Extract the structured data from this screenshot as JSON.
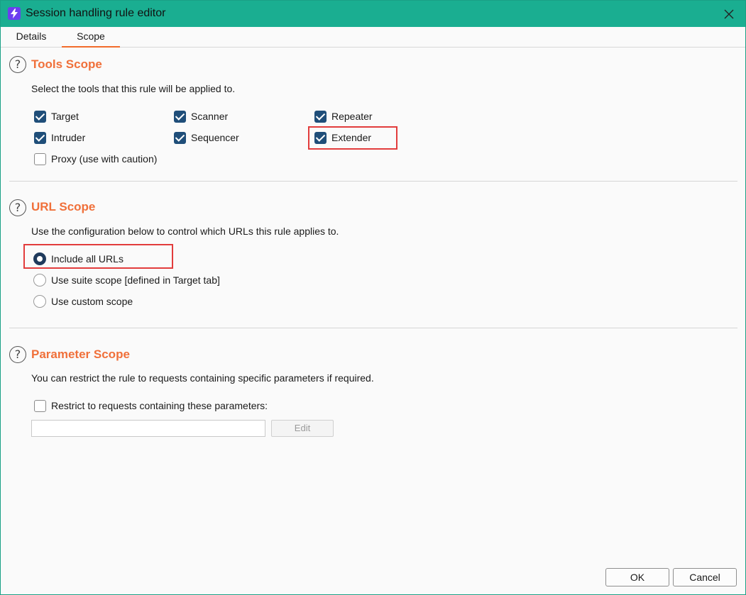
{
  "window": {
    "title": "Session handling rule editor",
    "app_icon": "burp-lightning-icon",
    "accent_color": "#1aae91"
  },
  "tabs": [
    {
      "label": "Details",
      "active": false
    },
    {
      "label": "Scope",
      "active": true
    }
  ],
  "tools_scope": {
    "title": "Tools Scope",
    "description": "Select the tools that this rule will be applied to.",
    "tools": [
      {
        "label": "Target",
        "checked": true
      },
      {
        "label": "Scanner",
        "checked": true
      },
      {
        "label": "Repeater",
        "checked": true
      },
      {
        "label": "Intruder",
        "checked": true
      },
      {
        "label": "Sequencer",
        "checked": true
      },
      {
        "label": "Extender",
        "checked": true
      },
      {
        "label": "Proxy (use with caution)",
        "checked": false
      }
    ]
  },
  "url_scope": {
    "title": "URL Scope",
    "description": "Use the configuration below to control which URLs this rule applies to.",
    "options": [
      {
        "label": "Include all URLs",
        "selected": true
      },
      {
        "label": "Use suite scope [defined in Target tab]",
        "selected": false
      },
      {
        "label": "Use custom scope",
        "selected": false
      }
    ]
  },
  "parameter_scope": {
    "title": "Parameter Scope",
    "description": "You can restrict the rule to requests containing specific parameters if required.",
    "restrict_label": "Restrict to requests containing these parameters:",
    "restrict_checked": false,
    "parameter_value": "",
    "edit_label": "Edit"
  },
  "buttons": {
    "ok_label": "OK",
    "cancel_label": "Cancel"
  },
  "colors": {
    "section_title": "#f0703a",
    "checkbox_checked": "#1f4e79",
    "highlight_box": "#e23c3c"
  }
}
